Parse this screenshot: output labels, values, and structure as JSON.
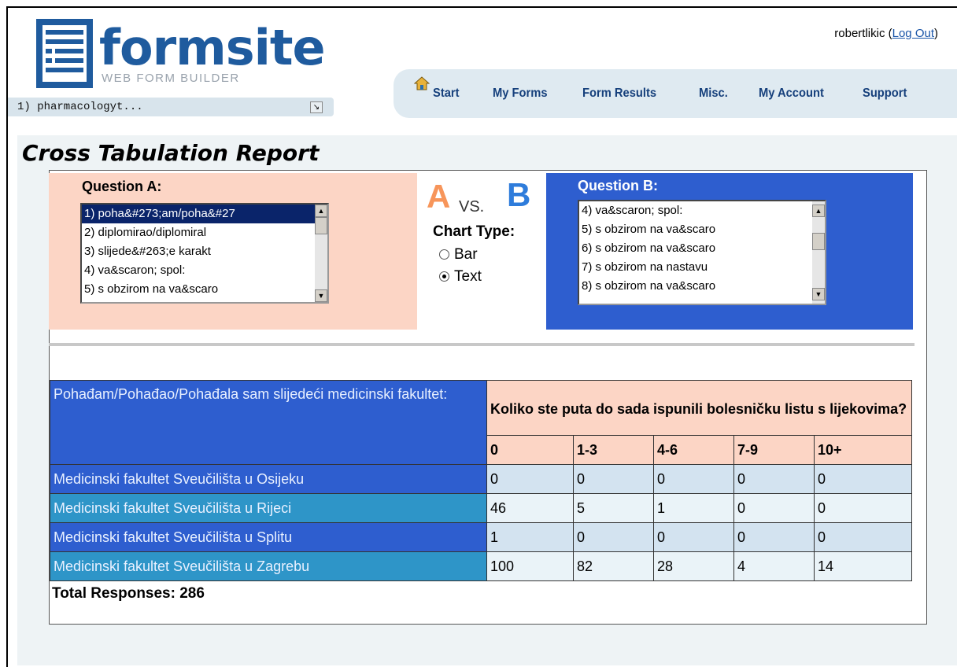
{
  "brand": {
    "name": "formsite",
    "tagline": "WEB FORM BUILDER",
    "name_color": "#1f5b9e"
  },
  "form_selector": {
    "value": "1) pharmacologyt..."
  },
  "user": {
    "username": "robertlikic",
    "logout_label": "Log Out"
  },
  "nav": {
    "items": [
      "Start",
      "My Forms",
      "Form Results",
      "Misc.",
      "My Account",
      "Support"
    ]
  },
  "report": {
    "title": "Cross Tabulation Report",
    "question_a_label": "Question A:",
    "question_b_label": "Question B:",
    "question_a_options": [
      "1) poha&#273;am/poha&#27",
      "2) diplomirao/diplomiral",
      "3) slijede&#263;e karakt",
      "4) va&scaron; spol:",
      "5) s obzirom na va&scaro"
    ],
    "question_a_selected_index": 0,
    "question_b_options": [
      "4) va&scaron; spol:",
      "5) s obzirom na va&scaro",
      "6) s obzirom na va&scaro",
      "7) s obzirom na nastavu",
      "8) s obzirom na va&scaro"
    ],
    "a_letter": "A",
    "vs_label": "VS.",
    "b_letter": "B",
    "chart_type_label": "Chart Type:",
    "chart_types": [
      "Bar",
      "Text"
    ],
    "chart_type_selected": "Text",
    "colors": {
      "question_a_bg": "#fcd5c5",
      "question_b_bg": "#2e5ecf",
      "a_letter": "#f7955a",
      "b_letter": "#2e7cdb"
    }
  },
  "table": {
    "row_header": "Pohađam/Pohađao/Pohađala sam slijedeći medicinski fakultet:",
    "column_header": "Koliko ste puta do sada ispunili bolesničku listu s lijekovima?",
    "columns": [
      "0",
      "1-3",
      "4-6",
      "7-9",
      "10+"
    ],
    "rows": [
      {
        "label": "Medicinski fakultet Sveučilišta u Osijeku",
        "values": [
          "0",
          "0",
          "0",
          "0",
          "0"
        ]
      },
      {
        "label": "Medicinski fakultet Sveučilišta u Rijeci",
        "values": [
          "46",
          "5",
          "1",
          "0",
          "0"
        ]
      },
      {
        "label": "Medicinski fakultet Sveučilišta u Splitu",
        "values": [
          "1",
          "0",
          "0",
          "0",
          "0"
        ]
      },
      {
        "label": "Medicinski fakultet Sveučilišta u Zagrebu",
        "values": [
          "100",
          "82",
          "28",
          "4",
          "14"
        ]
      }
    ],
    "row_label_colors": [
      "#2e5ecf",
      "#2e95c8",
      "#2e5ecf",
      "#2e95c8"
    ],
    "row_value_colors": [
      "#d3e3f0",
      "#eaf3f8",
      "#d3e3f0",
      "#eaf3f8"
    ]
  },
  "total_responses": "Total Responses: 286"
}
